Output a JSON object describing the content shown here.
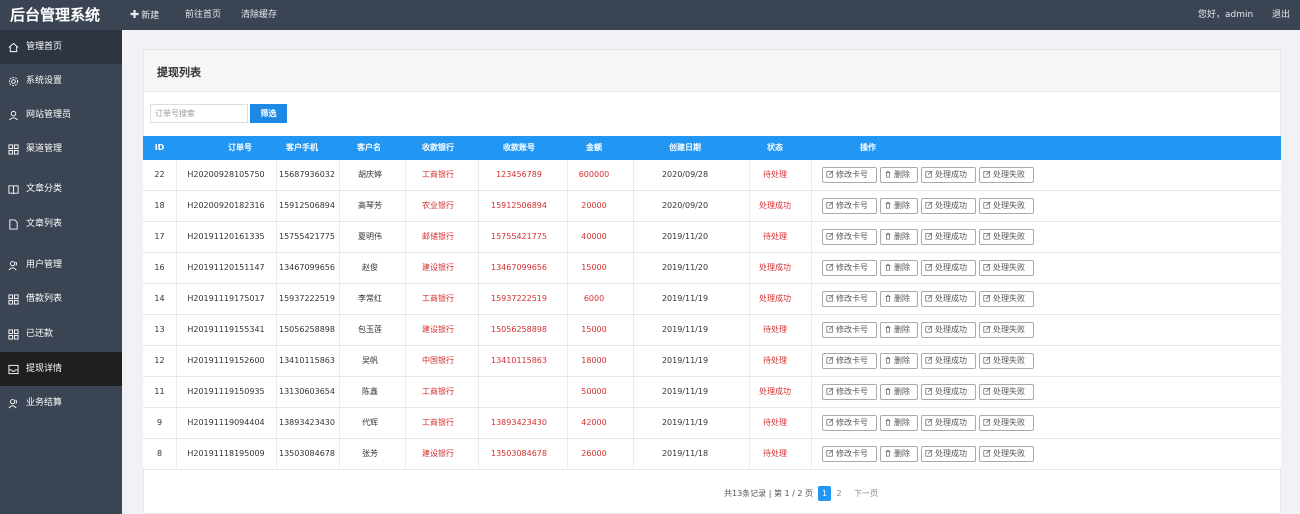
{
  "app": {
    "title": "后台管理系统"
  },
  "topnav": {
    "new_label": "新建",
    "home_label": "前往首页",
    "clear_label": "清除缓存",
    "greeting": "您好，admin",
    "logout": "退出"
  },
  "sidebar": {
    "items": [
      {
        "label": "管理首页",
        "icon": "home-icon"
      },
      {
        "label": "系统设置",
        "icon": "gear-icon"
      },
      {
        "label": "网站管理员",
        "icon": "user-icon"
      },
      {
        "label": "渠道管理",
        "icon": "grid-icon"
      },
      {
        "label": "文章分类",
        "icon": "book-icon"
      },
      {
        "label": "文章列表",
        "icon": "document-icon"
      },
      {
        "label": "用户管理",
        "icon": "users-icon"
      },
      {
        "label": "借款列表",
        "icon": "grid-icon"
      },
      {
        "label": "已还款",
        "icon": "grid-icon"
      },
      {
        "label": "提现详情",
        "icon": "inbox-icon"
      },
      {
        "label": "业务结算",
        "icon": "users-icon"
      }
    ]
  },
  "main": {
    "title": "提现列表",
    "search_placeholder": "订单号搜索",
    "filter_label": "筛选",
    "columns": [
      "ID",
      "订单号",
      "客户手机",
      "客户名",
      "收款银行",
      "收款账号",
      "金额",
      "创建日期",
      "状态",
      "操作"
    ],
    "actions": [
      "修改卡号",
      "删除",
      "处理成功",
      "处理失败"
    ],
    "rows": [
      {
        "id": "22",
        "order": "H20200928105750",
        "phone": "15687936032",
        "name": "胡庆婷",
        "bank": "工商银行",
        "account": "123456789",
        "amount": "600000",
        "date": "2020/09/28",
        "status": "待处理"
      },
      {
        "id": "18",
        "order": "H20200920182316",
        "phone": "15912506894",
        "name": "高琴芳",
        "bank": "农业银行",
        "account": "15912506894",
        "amount": "20000",
        "date": "2020/09/20",
        "status": "处理成功"
      },
      {
        "id": "17",
        "order": "H20191120161335",
        "phone": "15755421775",
        "name": "夏明伟",
        "bank": "邮储银行",
        "account": "15755421775",
        "amount": "40000",
        "date": "2019/11/20",
        "status": "待处理"
      },
      {
        "id": "16",
        "order": "H20191120151147",
        "phone": "13467099656",
        "name": "赵俊",
        "bank": "建设银行",
        "account": "13467099656",
        "amount": "15000",
        "date": "2019/11/20",
        "status": "处理成功"
      },
      {
        "id": "14",
        "order": "H20191119175017",
        "phone": "15937222519",
        "name": "李常红",
        "bank": "工商银行",
        "account": "15937222519",
        "amount": "6000",
        "date": "2019/11/19",
        "status": "处理成功"
      },
      {
        "id": "13",
        "order": "H20191119155341",
        "phone": "15056258898",
        "name": "包玉莲",
        "bank": "建设银行",
        "account": "15056258898",
        "amount": "15000",
        "date": "2019/11/19",
        "status": "待处理"
      },
      {
        "id": "12",
        "order": "H20191119152600",
        "phone": "13410115863",
        "name": "吴帆",
        "bank": "中国银行",
        "account": "13410115863",
        "amount": "18000",
        "date": "2019/11/19",
        "status": "待处理"
      },
      {
        "id": "11",
        "order": "H20191119150935",
        "phone": "13130603654",
        "name": "陈鑫",
        "bank": "工商银行",
        "account": "",
        "amount": "50000",
        "date": "2019/11/19",
        "status": "处理成功"
      },
      {
        "id": "9",
        "order": "H20191119094404",
        "phone": "13893423430",
        "name": "代辉",
        "bank": "工商银行",
        "account": "13893423430",
        "amount": "42000",
        "date": "2019/11/19",
        "status": "待处理"
      },
      {
        "id": "8",
        "order": "H20191118195009",
        "phone": "13503084678",
        "name": "张芳",
        "bank": "建设银行",
        "account": "13503084678",
        "amount": "26000",
        "date": "2019/11/18",
        "status": "待处理"
      }
    ],
    "pagination": {
      "info": "共13条记录 | 第 1 / 2 页",
      "current": "1",
      "next_page": "2",
      "next_label": "下一页"
    }
  },
  "colors": {
    "topbar": "#3b4453",
    "table_header": "#2196f3",
    "accent_red": "#d32f2f",
    "active_menu": "#1f1f1f"
  }
}
